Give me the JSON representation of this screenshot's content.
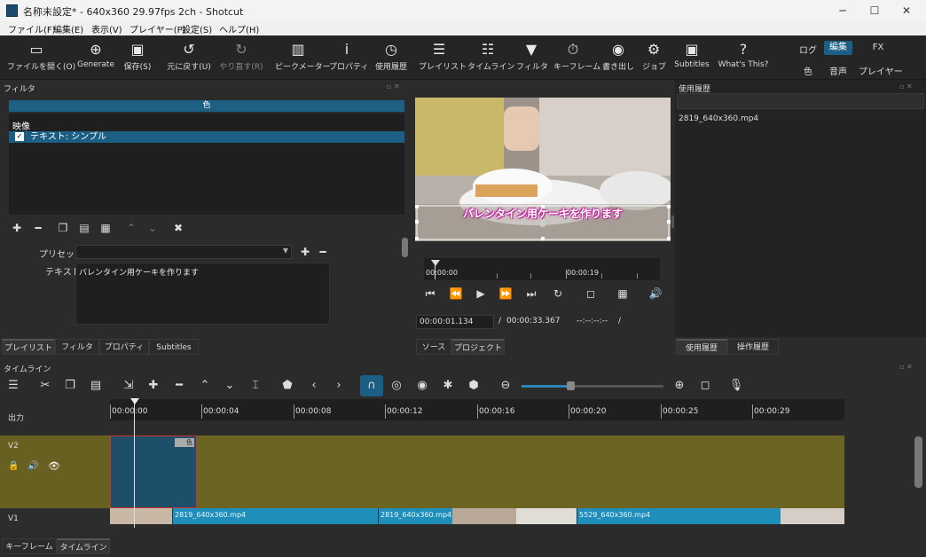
{
  "window": {
    "title": "名称未設定* - 640x360 29.97fps 2ch - Shotcut",
    "min": "─",
    "max": "☐",
    "close": "✕"
  },
  "menu": [
    "ファイル(F)",
    "編集(E)",
    "表示(V)",
    "プレイヤー(P)",
    "設定(S)",
    "ヘルプ(H)"
  ],
  "toolbar": {
    "open": "ファイルを開く(O)",
    "generate": "Generate",
    "save": "保存(S)",
    "undo": "元に戻す(U)",
    "redo": "やり直す(R)",
    "peak": "ピークメーター",
    "properties": "プロパティ",
    "recent": "使用履歴",
    "playlist": "プレイリスト",
    "timeline": "タイムライン",
    "filters": "フィルタ",
    "keyframes": "キーフレーム",
    "export": "書き出し",
    "jobs": "ジョブ",
    "subtitles": "Subtitles",
    "whatsthis": "What's This?",
    "layout": {
      "log": "ログ",
      "edit": "編集",
      "fx": "FX",
      "color": "色",
      "audio": "音声",
      "player": "プレイヤー"
    }
  },
  "filters_panel": {
    "title": "フィルタ",
    "color_label": "色",
    "section": "映像",
    "item": "テキスト: シンプル",
    "preset_label": "プリセット",
    "text_label": "テキスト",
    "text_value": "バレンタイン用ケーキを作ります"
  },
  "left_tabs": [
    "プレイリスト",
    "フィルタ",
    "プロパティ",
    "Subtitles"
  ],
  "player": {
    "overlay_text": "バレンタイン用ケーキを作ります",
    "ruler_start": "00:00:00",
    "ruler_mid": "00:00:19",
    "current": "00:00:01.134",
    "separator": "/",
    "duration": "00:00:33.367",
    "in_out": "--:--:--:--",
    "in_out_sep": "/",
    "tabs": [
      "ソース",
      "プロジェクト"
    ]
  },
  "history_panel": {
    "title": "使用履歴",
    "item": "2819_640x360.mp4",
    "tabs": [
      "使用履歴",
      "操作履歴"
    ]
  },
  "timeline_panel": {
    "title": "タイムライン",
    "ruler": [
      "00:00:00",
      "00:00:04",
      "00:00:08",
      "00:00:12",
      "00:00:16",
      "00:00:20",
      "00:00:25",
      "00:00:29"
    ],
    "output_label": "出力",
    "v2_label": "V2",
    "v1_label": "V1",
    "v2_clip_badge": "色",
    "v1_clips": [
      "2819_640x360.mp4",
      "2819_640x360.mp4",
      "5529_640x360.mp4"
    ]
  },
  "bottom_tabs": [
    "キーフレーム",
    "タイムライン"
  ],
  "icons": {
    "lock": "🔒",
    "speaker": "🔊",
    "eye": "👁"
  }
}
